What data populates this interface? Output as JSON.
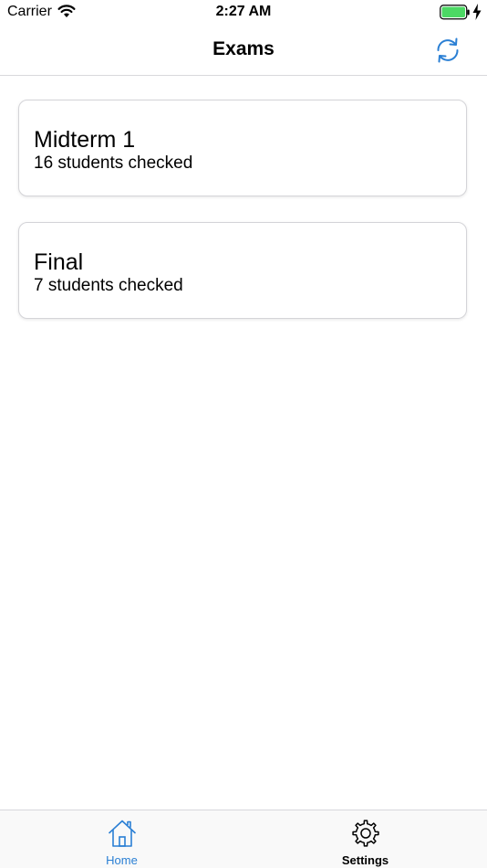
{
  "status_bar": {
    "carrier": "Carrier",
    "time": "2:27 AM",
    "battery_level": 1.0,
    "charging": true
  },
  "nav": {
    "title": "Exams",
    "refresh_icon": "refresh-icon"
  },
  "exams": [
    {
      "title": "Midterm 1",
      "subtitle": "16 students checked"
    },
    {
      "title": "Final",
      "subtitle": "7 students checked"
    }
  ],
  "tabs": [
    {
      "label": "Home",
      "icon": "home-icon",
      "selected": true
    },
    {
      "label": "Settings",
      "icon": "gear-icon",
      "selected": false
    }
  ],
  "colors": {
    "accent": "#2a7fd4",
    "battery": "#4cd964",
    "text": "#000000",
    "separator": "#d8d8dc"
  }
}
